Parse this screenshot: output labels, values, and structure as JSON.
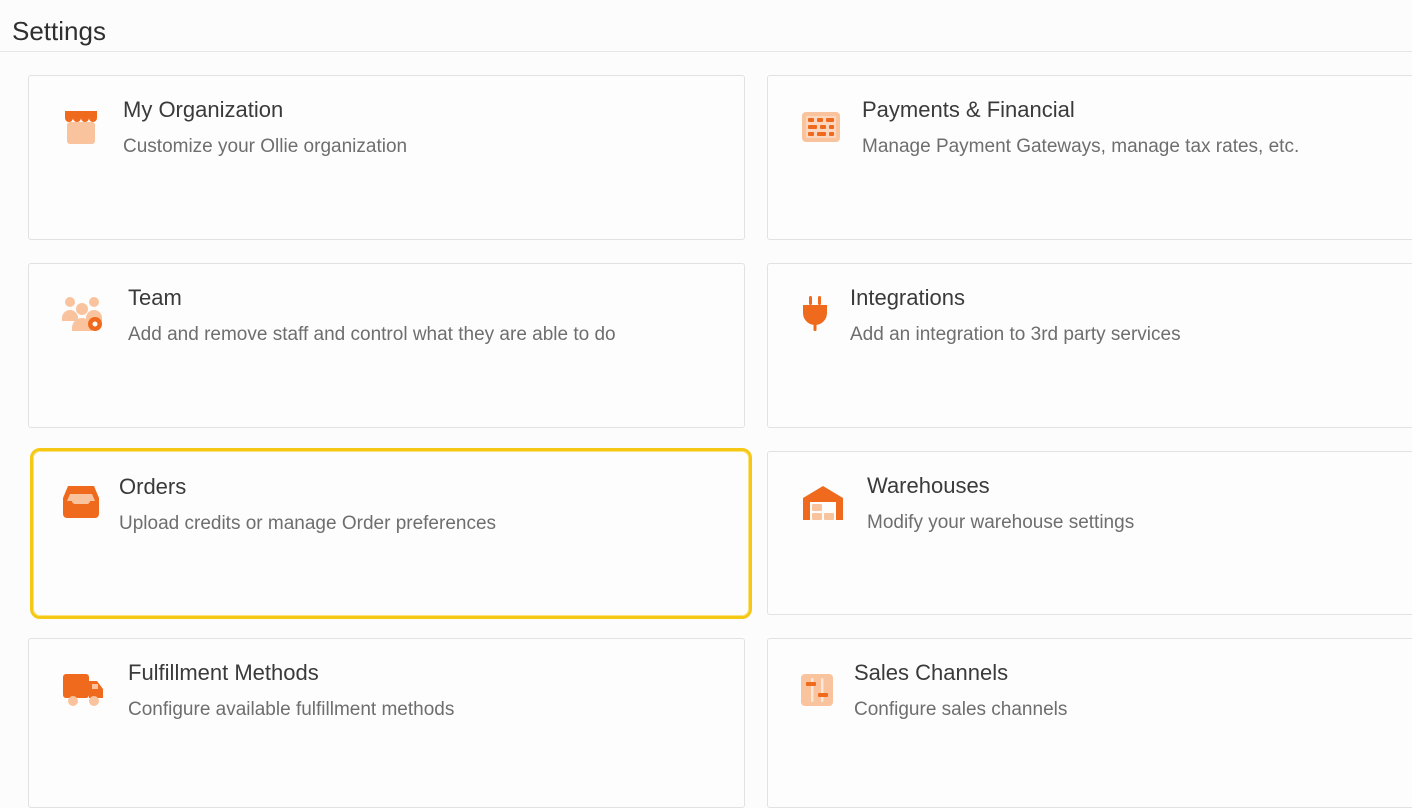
{
  "page": {
    "title": "Settings"
  },
  "colors": {
    "accent_orange": "#f06a1d",
    "accent_peach": "#f9c39d",
    "focus_ring": "#f6c816"
  },
  "cards": [
    {
      "id": "my-organization",
      "title": "My Organization",
      "description": "Customize your Ollie organization",
      "icon": "storefront-icon"
    },
    {
      "id": "payments-financial",
      "title": "Payments & Financial",
      "description": "Manage Payment Gateways, manage tax rates, etc.",
      "icon": "abacus-icon"
    },
    {
      "id": "team",
      "title": "Team",
      "description": "Add and remove staff and control what they are able to do",
      "icon": "team-settings-icon"
    },
    {
      "id": "integrations",
      "title": "Integrations",
      "description": "Add an integration to 3rd party services",
      "icon": "plug-icon"
    },
    {
      "id": "orders",
      "title": "Orders",
      "description": "Upload credits or manage Order preferences",
      "icon": "inbox-tray-icon"
    },
    {
      "id": "warehouses",
      "title": "Warehouses",
      "description": "Modify your warehouse settings",
      "icon": "warehouse-icon"
    },
    {
      "id": "fulfillment-methods",
      "title": "Fulfillment Methods",
      "description": "Configure available fulfillment methods",
      "icon": "delivery-truck-icon"
    },
    {
      "id": "sales-channels",
      "title": "Sales Channels",
      "description": "Configure sales channels",
      "icon": "sliders-icon"
    }
  ]
}
